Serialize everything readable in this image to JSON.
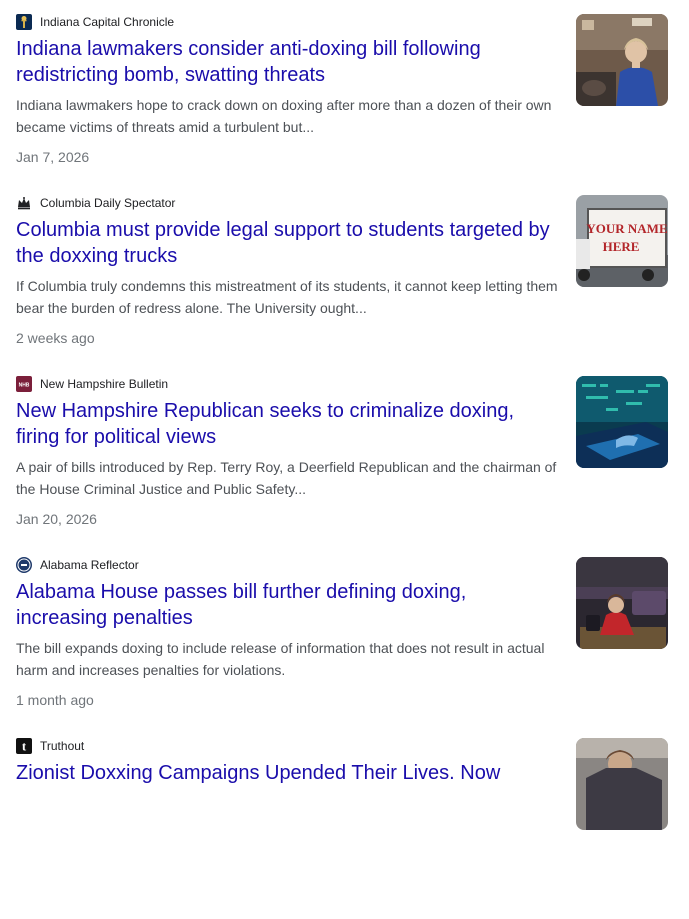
{
  "results": [
    {
      "source": "Indiana Capital Chronicle",
      "favicon_icon": "torch-icon",
      "favicon_color": "#0b2a52",
      "title": "Indiana lawmakers consider anti-doxing bill following redistricting bomb, swatting threats",
      "snippet": "Indiana lawmakers hope to crack down on doxing after more than a dozen of their own became victims of threats amid a turbulent but...",
      "date": "Jan 7, 2026"
    },
    {
      "source": "Columbia Daily Spectator",
      "favicon_icon": "crown-icon",
      "favicon_color": "#202124",
      "title": "Columbia must provide legal support to students targeted by the doxxing trucks",
      "snippet": "If Columbia truly condemns this mistreatment of its students, it cannot keep letting them bear the burden of redress alone. The University ought...",
      "date": "2 weeks ago",
      "thumb_text_line1": "YOUR NAME",
      "thumb_text_line2": "HERE"
    },
    {
      "source": "New Hampshire Bulletin",
      "favicon_icon": "nhb-logo-icon",
      "favicon_color": "#7b1f3a",
      "favicon_text": "NHB",
      "title": "New Hampshire Republican seeks to criminalize doxing, firing for political views",
      "snippet": "A pair of bills introduced by Rep. Terry Roy, a Deerfield Republican and the chairman of the House Criminal Justice and Public Safety...",
      "date": "Jan 20, 2026"
    },
    {
      "source": "Alabama Reflector",
      "favicon_icon": "seal-icon",
      "favicon_color": "#1f3a6b",
      "title": "Alabama House passes bill further defining doxing, increasing penalties",
      "snippet": "The bill expands doxing to include release of information that does not result in actual harm and increases penalties for violations.",
      "date": "1 month ago"
    },
    {
      "source": "Truthout",
      "favicon_icon": "truthout-t-icon",
      "favicon_color": "#111111",
      "favicon_text": "t",
      "title": "Zionist Doxxing Campaigns Upended Their Lives. Now",
      "snippet": "",
      "date": ""
    }
  ],
  "colors": {
    "link": "#1a0dab",
    "snippet": "#4d5156",
    "meta": "#70757a"
  }
}
